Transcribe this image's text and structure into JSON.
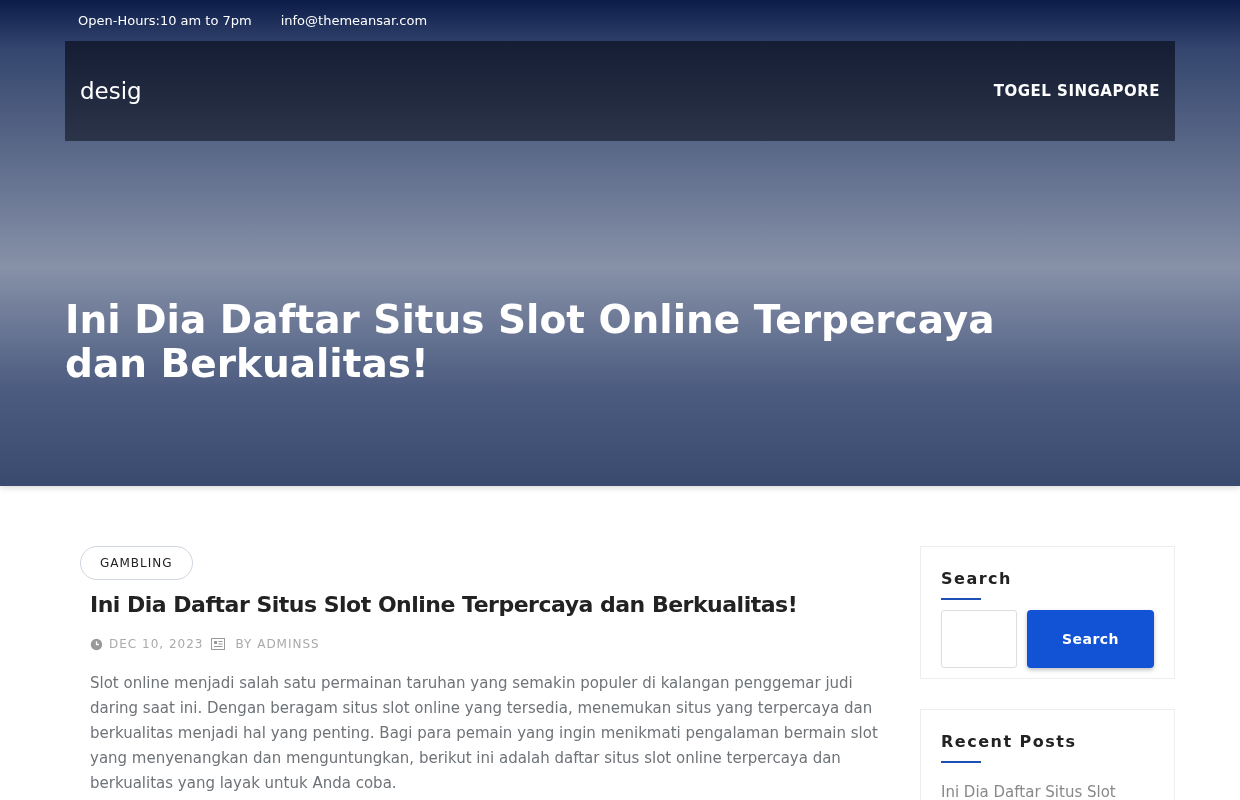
{
  "topbar": {
    "hours": "Open-Hours:10 am to 7pm",
    "email": "info@themeansar.com"
  },
  "header": {
    "logo": "desig",
    "nav": [
      {
        "label": "TOGEL SINGAPORE"
      }
    ]
  },
  "hero": {
    "title": "Ini Dia Daftar Situs Slot Online Terpercaya dan Berkualitas!"
  },
  "post": {
    "category": "GAMBLING",
    "title": "Ini Dia Daftar Situs Slot Online Terpercaya dan Berkualitas!",
    "date": "DEC 10, 2023",
    "author": "BY ADMINSS",
    "excerpt": "Slot online menjadi salah satu permainan taruhan yang semakin populer di kalangan penggemar judi daring saat ini. Dengan beragam situs slot online yang tersedia, menemukan situs yang terpercaya dan berkualitas menjadi hal yang penting. Bagi para pemain yang ingin menikmati pengalaman bermain slot yang menyenangkan dan menguntungkan, berikut ini adalah daftar situs slot online terpercaya dan berkualitas yang layak untuk Anda coba."
  },
  "sidebar": {
    "search": {
      "title": "Search",
      "button": "Search"
    },
    "recent": {
      "title": "Recent Posts",
      "items": [
        "Ini Dia Daftar Situs Slot"
      ]
    }
  }
}
